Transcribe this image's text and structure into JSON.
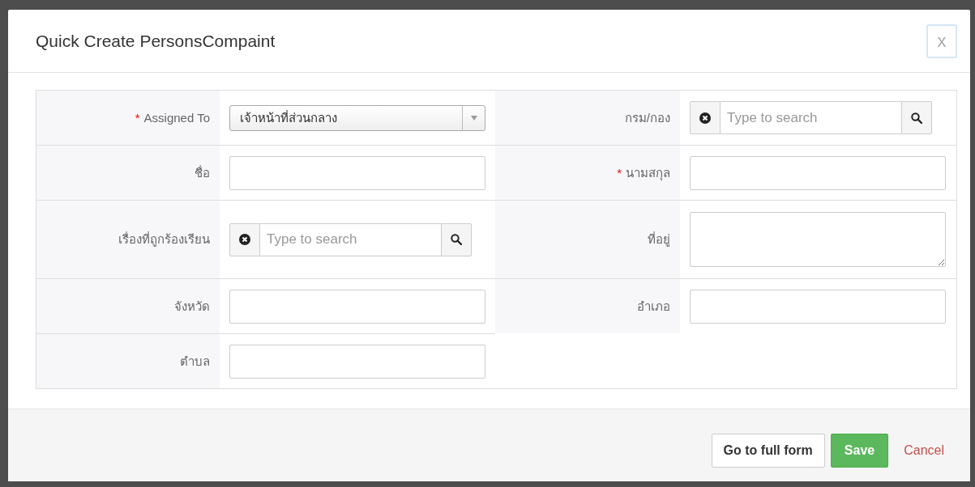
{
  "dialog": {
    "title": "Quick Create PersonsCompaint",
    "close": "x"
  },
  "rows": [
    {
      "fields": [
        {
          "label": "Assigned To",
          "required_mark": "*",
          "kind": "select",
          "value": "เจ้าหน้าที่ส่วนกลาง"
        },
        {
          "label": "กรม/กอง",
          "kind": "reference",
          "placeholder": "Type to search"
        }
      ]
    },
    {
      "fields": [
        {
          "label": "ชื่อ",
          "kind": "text"
        },
        {
          "label": "นามสกุล",
          "required_mark": "*",
          "kind": "text"
        }
      ]
    },
    {
      "fields": [
        {
          "label": "เรื่องที่ถูกร้องเรียน",
          "kind": "reference",
          "placeholder": "Type to search"
        },
        {
          "label": "ที่อยู่",
          "kind": "textarea"
        }
      ]
    },
    {
      "fields": [
        {
          "label": "จังหวัด",
          "kind": "text"
        },
        {
          "label": "อำเภอ",
          "kind": "text"
        }
      ]
    },
    {
      "fields": [
        {
          "label": "ตำบล",
          "kind": "text"
        }
      ]
    }
  ],
  "buttons": [
    {
      "label": "Go to full form",
      "kind": "default"
    },
    {
      "label": "Save",
      "kind": "primary"
    },
    {
      "label": "Cancel",
      "kind": "link"
    }
  ]
}
